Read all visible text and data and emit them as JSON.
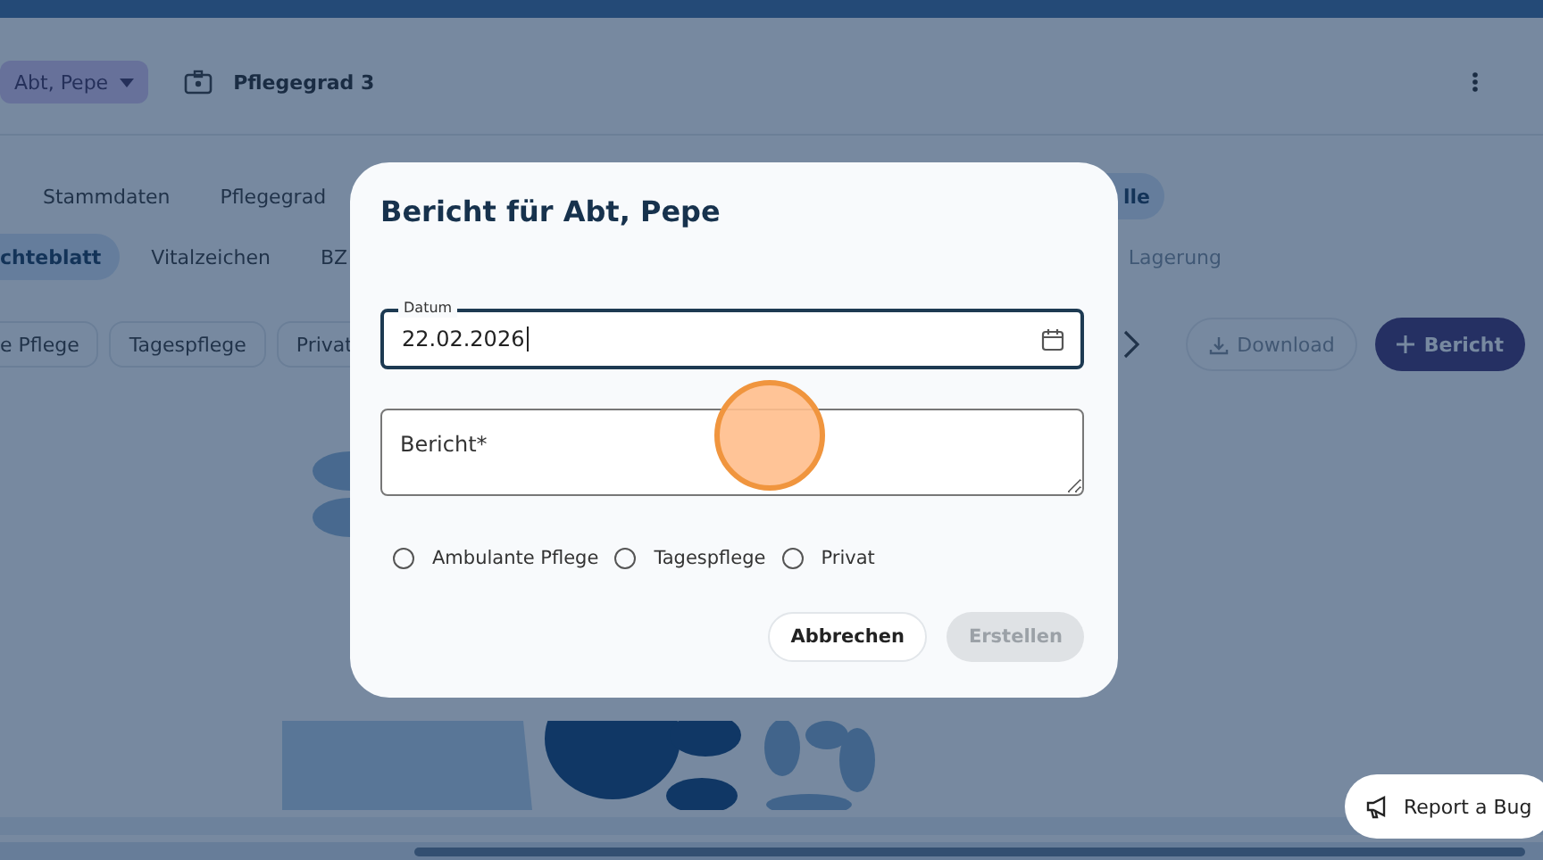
{
  "header": {
    "patient": "Abt, Pepe",
    "care_level": "Pflegegrad 3"
  },
  "tabs_primary": [
    {
      "label": "Stammdaten",
      "selected": false
    },
    {
      "label": "Pflegegrad",
      "selected": false
    },
    {
      "label": "lle",
      "selected": true
    }
  ],
  "tabs_secondary": [
    {
      "label": "chteblatt",
      "selected": true,
      "disabled": false
    },
    {
      "label": "Vitalzeichen",
      "selected": false,
      "disabled": false
    },
    {
      "label": "BZ",
      "selected": false,
      "disabled": false
    },
    {
      "label": "Lagerung",
      "selected": false,
      "disabled": true
    }
  ],
  "filters": [
    {
      "label": "e Pflege"
    },
    {
      "label": "Tagespflege"
    },
    {
      "label": "Privat"
    }
  ],
  "actions": {
    "download": "Download",
    "download_disabled": true,
    "create": "Bericht"
  },
  "dialog": {
    "title": "Bericht für Abt, Pepe",
    "date_label": "Datum",
    "date_value": "22.02.2026",
    "report_placeholder": "Bericht*",
    "care_types": [
      {
        "label": "Ambulante Pflege",
        "selected": false
      },
      {
        "label": "Tagespflege",
        "selected": false
      },
      {
        "label": "Privat",
        "selected": false
      }
    ],
    "cancel": "Abbrechen",
    "submit": "Erstellen",
    "submit_disabled": true
  },
  "report_bug": "Report a Bug"
}
